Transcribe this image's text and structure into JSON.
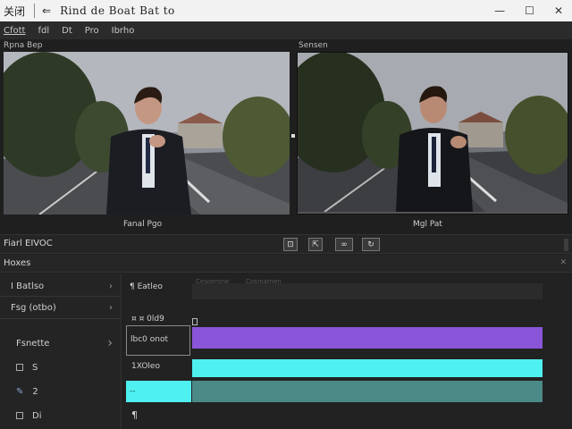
{
  "app": {
    "title": "关闭",
    "back_icon": "back-arrow-icon",
    "document_title": "Rind de Boat Bat to"
  },
  "window_controls": {
    "minimize": "—",
    "maximize": "☐",
    "close": "✕"
  },
  "menu": [
    "Cfott",
    "fdl",
    "Dt",
    "Pro",
    "Ibrho"
  ],
  "viewers": {
    "left": {
      "label": "Rpna Bep",
      "caption": "Fanal Pgo"
    },
    "right": {
      "label": "Sensen",
      "caption": "Mgl Pat"
    }
  },
  "controls": {
    "label": "Fiarl EIVOC",
    "tool_icons": [
      "crop-icon",
      "export-icon",
      "link-icon",
      "rotate-icon"
    ]
  },
  "panel": {
    "title": "Hoxes"
  },
  "left_items": [
    {
      "label": "I Batlso",
      "has_arrow": true
    },
    {
      "label": "Fsg (otbo)",
      "has_arrow": true
    },
    {
      "label": "Fsnette",
      "has_arrow": true
    },
    {
      "label": "S",
      "has_checkbox": true
    },
    {
      "label": "2",
      "icon": "pen-icon"
    },
    {
      "label": "Di",
      "has_checkbox": true
    }
  ],
  "tracks": {
    "ruler_text": [
      "Cesoerone",
      "Cosmarnen"
    ],
    "rows": [
      {
        "label": "¶ Eatleo"
      },
      {
        "label": "¤ ¤ 0ld9"
      },
      {
        "label": "lbc0 onot"
      },
      {
        "label": "1XOleo"
      },
      {
        "label": "--"
      },
      {
        "label": "¶"
      }
    ]
  },
  "colors": {
    "purple_clip": "#8a55d8",
    "cyan_clip": "#4ff0f0",
    "teal_clip": "#4b8a86"
  }
}
